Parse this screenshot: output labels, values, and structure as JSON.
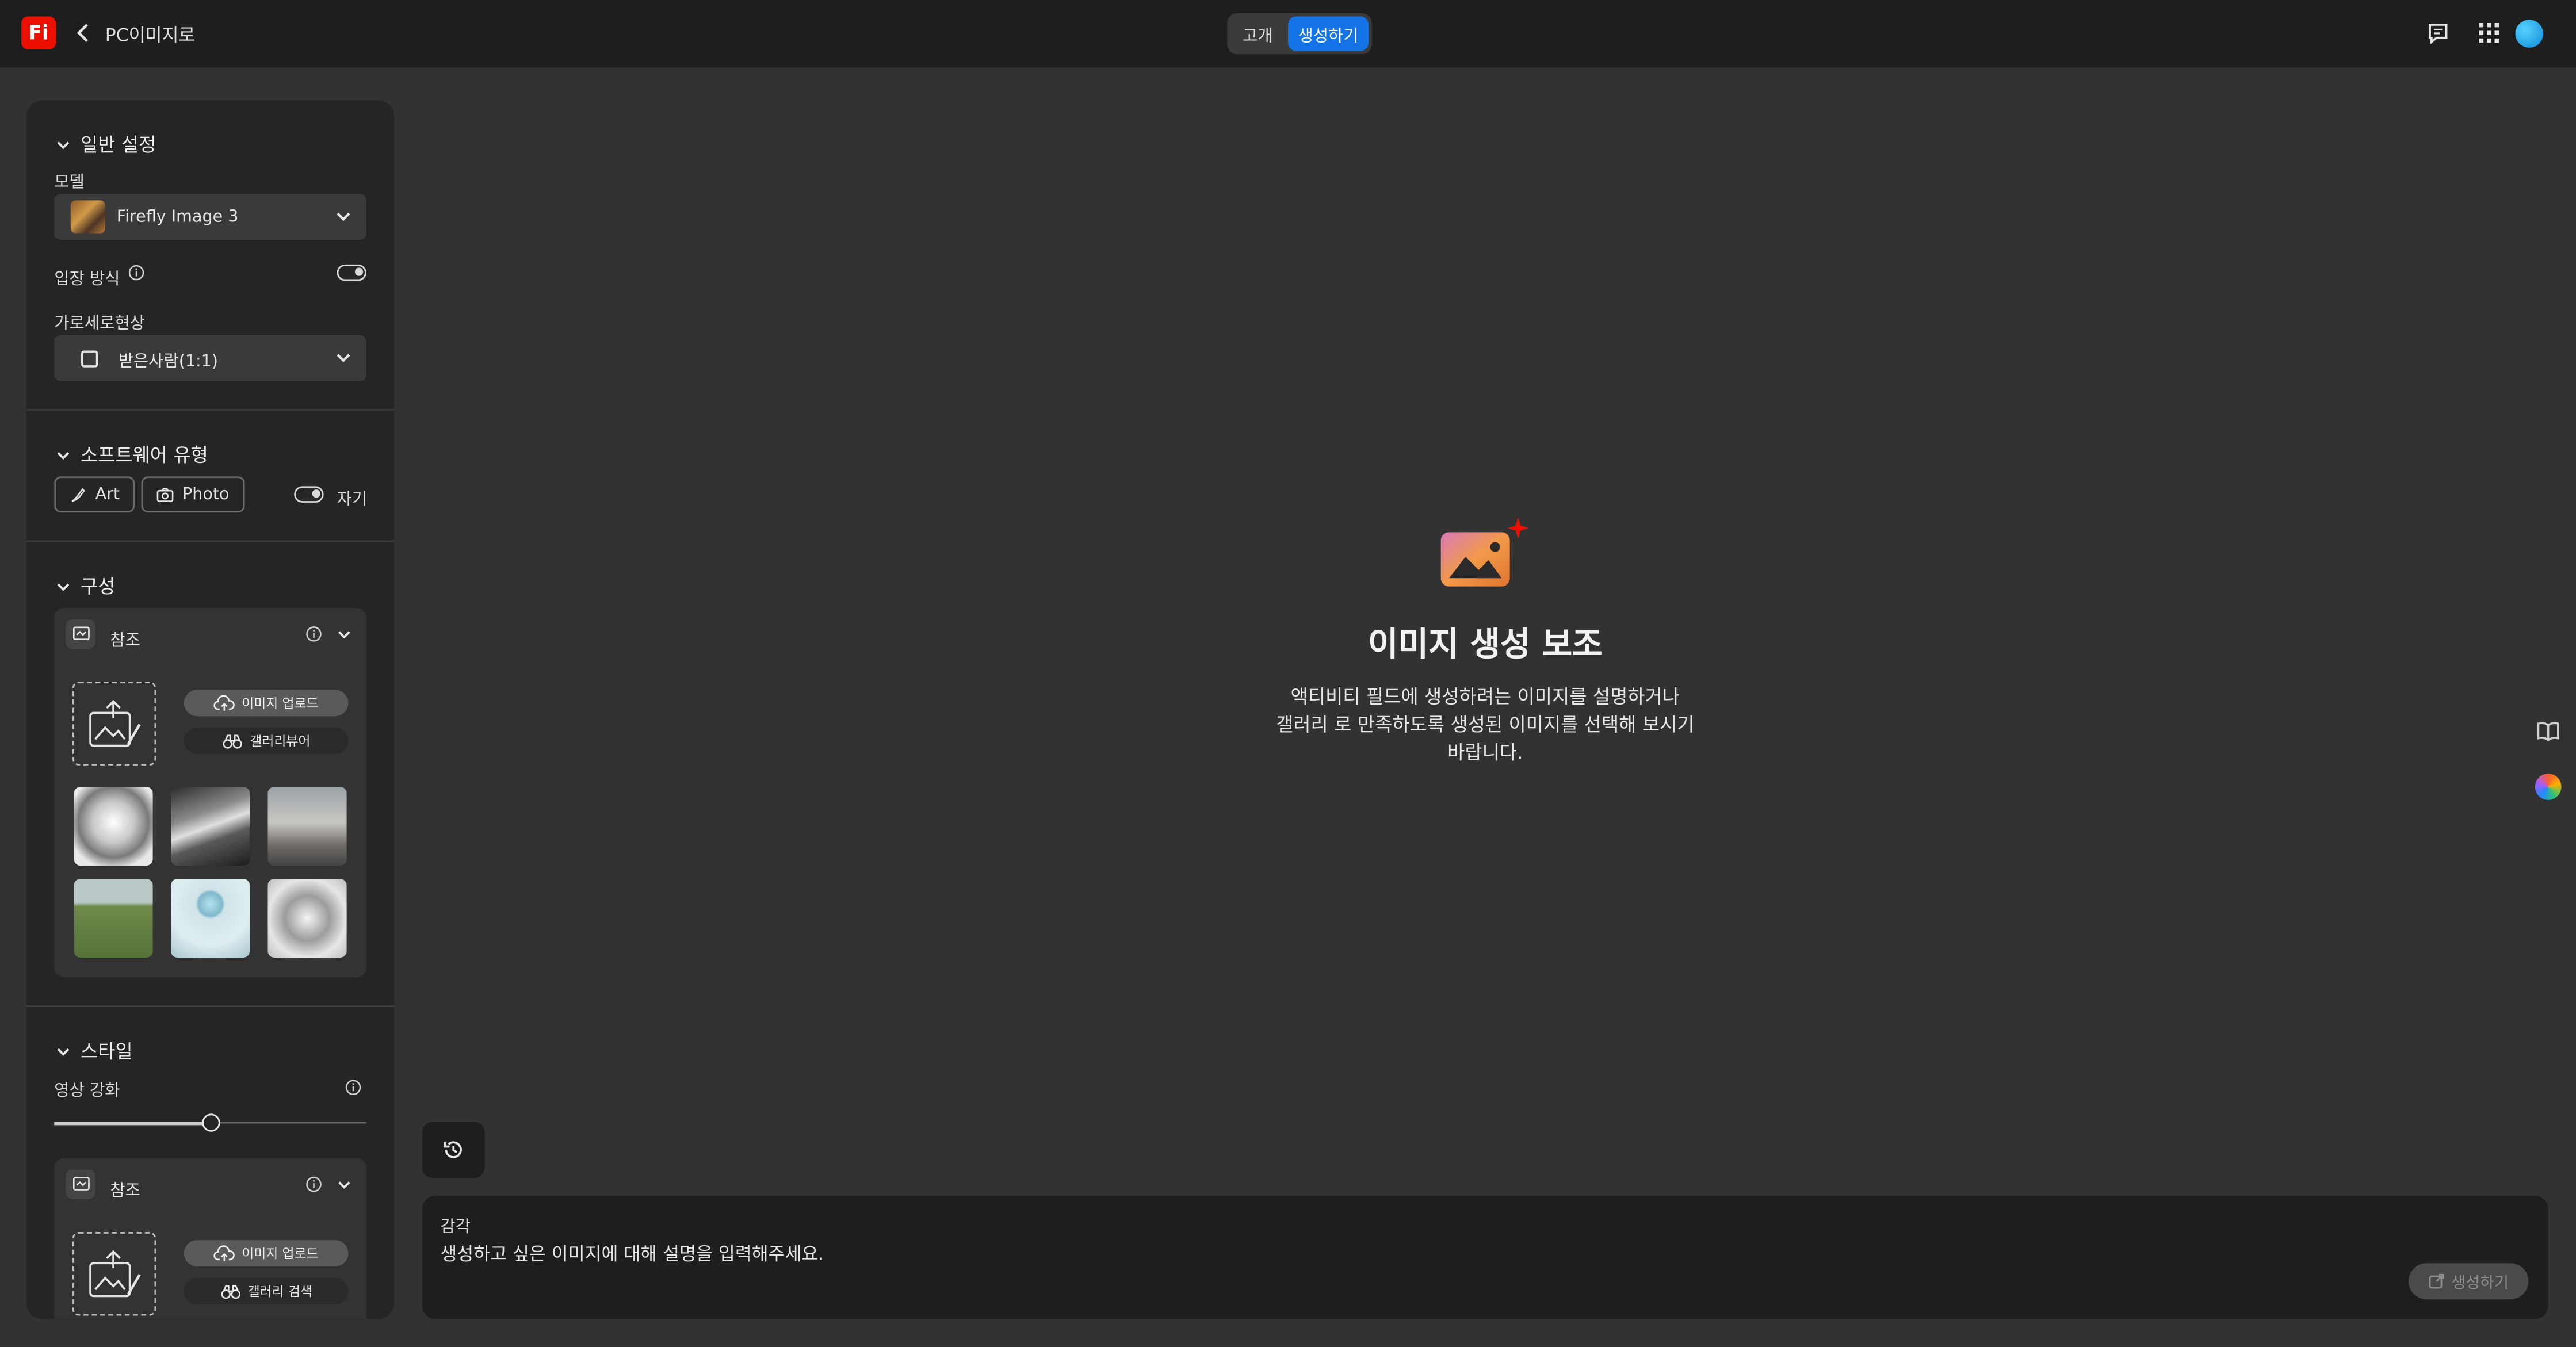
{
  "header": {
    "logo": "Fi",
    "breadcrumb": "PC이미지로",
    "tabs": [
      {
        "label": "고개"
      },
      {
        "label": "생성하기"
      }
    ]
  },
  "sidebar": {
    "general": {
      "title": "일반 설정",
      "model_label": "모델",
      "model_value": "Firefly Image 3",
      "mode_label": "입장 방식",
      "aspect_label": "가로세로현상",
      "aspect_value": "받은사람(1:1)"
    },
    "content_type": {
      "title": "소프트웨어 유형",
      "art": "Art",
      "photo": "Photo",
      "auto": "자기"
    },
    "composition": {
      "title": "구성",
      "ref_title": "참조",
      "upload": "이미지 업로드",
      "gallery": "갤러리뷰어"
    },
    "style": {
      "title": "스타일",
      "strength_label": "영상 강화",
      "strength_value": 0.5,
      "ref_title": "참조",
      "upload": "이미지 업로드",
      "gallery": "갤러리 검색"
    }
  },
  "main": {
    "title": "이미지 생성 보조",
    "description_lines": [
      "액티비티 필드에 생성하려는 이미지를 설명하거나",
      "갤러리 로 만족하도록 생성된 이미지를 선택해 보시기",
      "바랍니다."
    ]
  },
  "prompt": {
    "label": "감각",
    "placeholder": "생성하고 싶은 이미지에 대해 설명을 입력해주세요.",
    "generate": "생성하기"
  },
  "colors": {
    "accent": "#1473e6",
    "brand": "#eb1000"
  }
}
